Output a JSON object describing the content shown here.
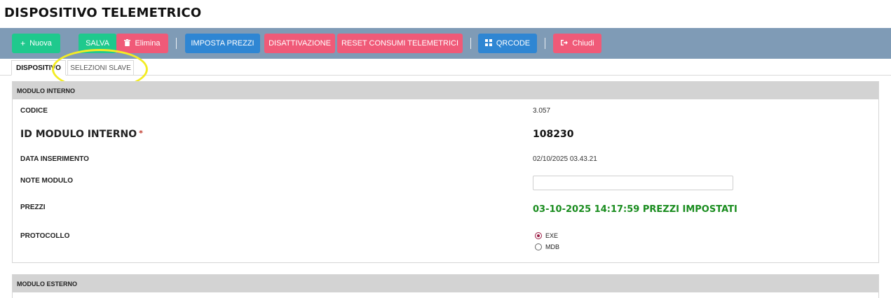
{
  "page": {
    "title": "DISPOSITIVO TELEMETRICO"
  },
  "toolbar": {
    "nuova_label": "Nuova",
    "salva_label": "SALVA",
    "elimina_label": "Elimina",
    "imposta_prezzi_label": "IMPOSTA PREZZI",
    "disattivazione_label": "DISATTIVAZIONE",
    "reset_label": "RESET CONSUMI TELEMETRICI",
    "qrcode_label": "QRCODE",
    "chiudi_label": "Chiudi",
    "colors": {
      "bar": "#7f9bb6",
      "green": "#1fc98d",
      "red": "#f05a78",
      "blue": "#2f86d3"
    }
  },
  "tabs": [
    {
      "label": "DISPOSITIVO",
      "active": true
    },
    {
      "label": "SELEZIONI SLAVE",
      "active": false
    }
  ],
  "modulo_interno": {
    "header": "MODULO INTERNO",
    "codice_label": "CODICE",
    "codice_value": "3.057",
    "id_label": "ID MODULO INTERNO",
    "required_mark": "*",
    "id_value": "108230",
    "data_label": "DATA INSERIMENTO",
    "data_value": "02/10/2025 03.43.21",
    "note_label": "NOTE MODULO",
    "note_value": "",
    "prezzi_label": "PREZZI",
    "prezzi_value": "03-10-2025 14:17:59 PREZZI IMPOSTATI",
    "protocollo_label": "PROTOCOLLO",
    "protocollo_options": [
      {
        "label": "EXE",
        "selected": true
      },
      {
        "label": "MDB",
        "selected": false
      }
    ]
  },
  "modulo_esterno": {
    "header": "MODULO ESTERNO"
  },
  "annotation": {
    "color": "#f3ec24"
  }
}
